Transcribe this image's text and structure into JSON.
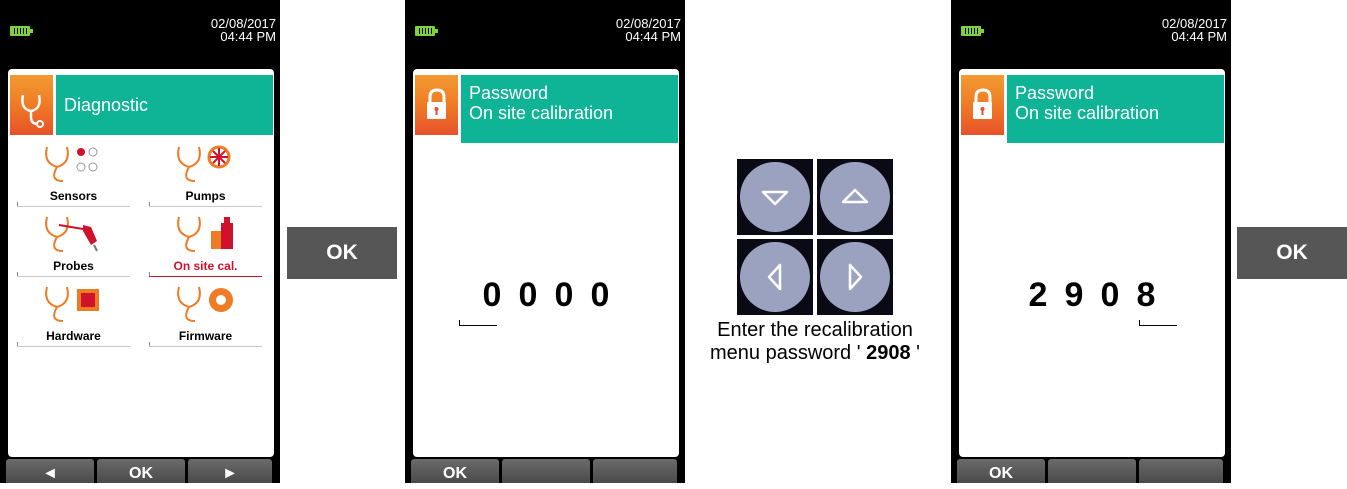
{
  "datetime": {
    "date": "02/08/2017",
    "time": "04:44 PM"
  },
  "screen1": {
    "header": "Diagnostic",
    "items": [
      {
        "label": "Sensors",
        "icon": "stethoscope-sensors-icon"
      },
      {
        "label": "Pumps",
        "icon": "stethoscope-pump-icon"
      },
      {
        "label": "Probes",
        "icon": "stethoscope-probe-icon"
      },
      {
        "label": "On site cal.",
        "icon": "stethoscope-weights-icon",
        "selected": true
      },
      {
        "label": "Hardware",
        "icon": "stethoscope-chip-icon"
      },
      {
        "label": "Firmware",
        "icon": "stethoscope-disc-icon"
      }
    ],
    "softkeys": {
      "left": "◄",
      "center": "OK",
      "right": "►"
    }
  },
  "ok_label": "OK",
  "screen2": {
    "header_line1": "Password",
    "header_line2": "On site calibration",
    "digits": [
      "0",
      "0",
      "0",
      "0"
    ],
    "softkey": "OK"
  },
  "instruction": {
    "prefix": "Enter the recalibration menu password ' ",
    "code": "2908",
    "suffix": " '"
  },
  "screen3": {
    "header_line1": "Password",
    "header_line2": "On site calibration",
    "digits": [
      "2",
      "9",
      "0",
      "8"
    ],
    "softkey": "OK"
  },
  "colors": {
    "orange": "#ef7b25",
    "teal": "#0fb396",
    "red": "#d0112b",
    "key_gray": "#565656",
    "battery": "#7fd23a"
  }
}
